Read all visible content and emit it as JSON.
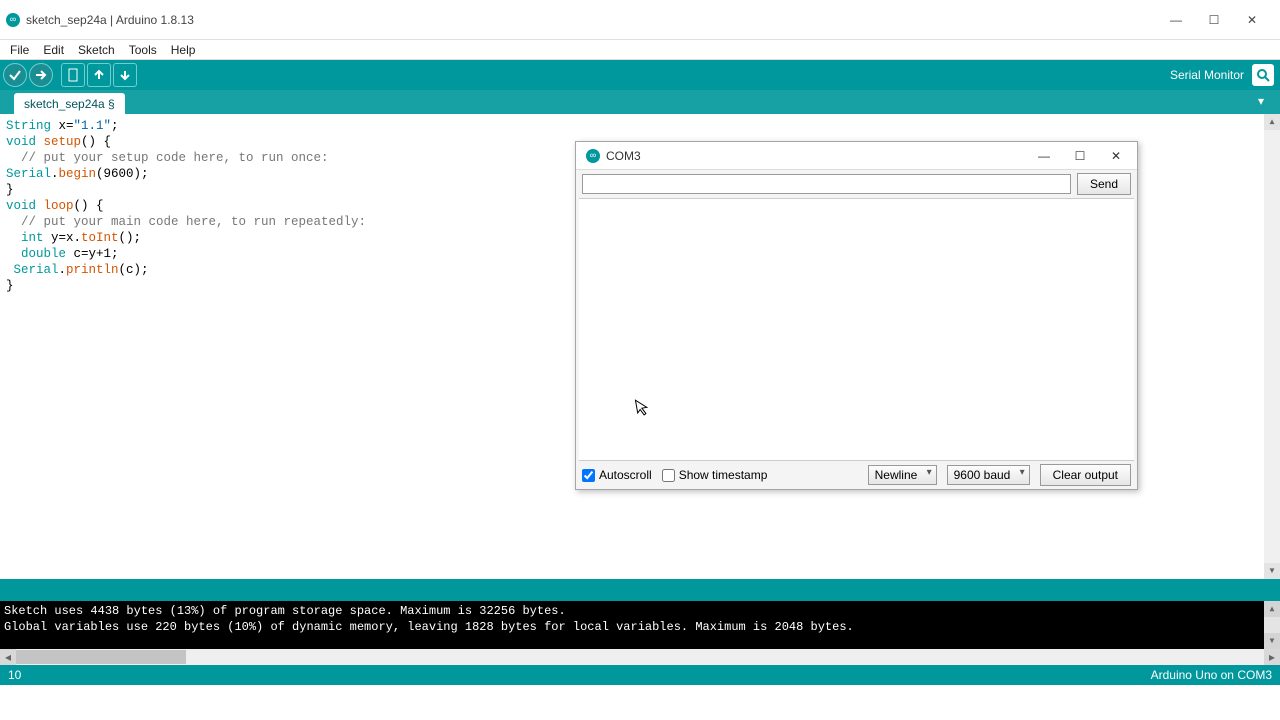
{
  "window": {
    "title": "sketch_sep24a | Arduino 1.8.13"
  },
  "menu": {
    "file": "File",
    "edit": "Edit",
    "sketch": "Sketch",
    "tools": "Tools",
    "help": "Help"
  },
  "toolbar": {
    "serial_monitor_label": "Serial Monitor"
  },
  "tab": {
    "name": "sketch_sep24a §"
  },
  "code": {
    "l1_a": "String",
    "l1_b": " x=",
    "l1_c": "\"1.1\"",
    "l1_d": ";",
    "l2_a": "void",
    "l2_b": " ",
    "l2_c": "setup",
    "l2_d": "() {",
    "l3": "  // put your setup code here, to run once:",
    "l4_a": "Serial",
    "l4_b": ".",
    "l4_c": "begin",
    "l4_d": "(9600);",
    "l5": "}",
    "l6": "",
    "l7_a": "void",
    "l7_b": " ",
    "l7_c": "loop",
    "l7_d": "() {",
    "l8": "  // put your main code here, to run repeatedly:",
    "l9_a": "  int",
    "l9_b": " y=x.",
    "l9_c": "toInt",
    "l9_d": "();",
    "l10_a": "  double",
    "l10_b": " c=y+1;",
    "l11": "",
    "l12_a": " Serial",
    "l12_b": ".",
    "l12_c": "println",
    "l12_d": "(c);",
    "l13": "",
    "l14": "}"
  },
  "console": {
    "line1": "Sketch uses 4438 bytes (13%) of program storage space. Maximum is 32256 bytes.",
    "line2": "Global variables use 220 bytes (10%) of dynamic memory, leaving 1828 bytes for local variables. Maximum is 2048 bytes."
  },
  "footer": {
    "left": "10",
    "right": "Arduino Uno on COM3"
  },
  "serial": {
    "title": "COM3",
    "input_value": "",
    "send": "Send",
    "autoscroll": "Autoscroll",
    "autoscroll_checked": true,
    "timestamp": "Show timestamp",
    "timestamp_checked": false,
    "line_ending": "Newline",
    "baud": "9600 baud",
    "clear": "Clear output"
  }
}
